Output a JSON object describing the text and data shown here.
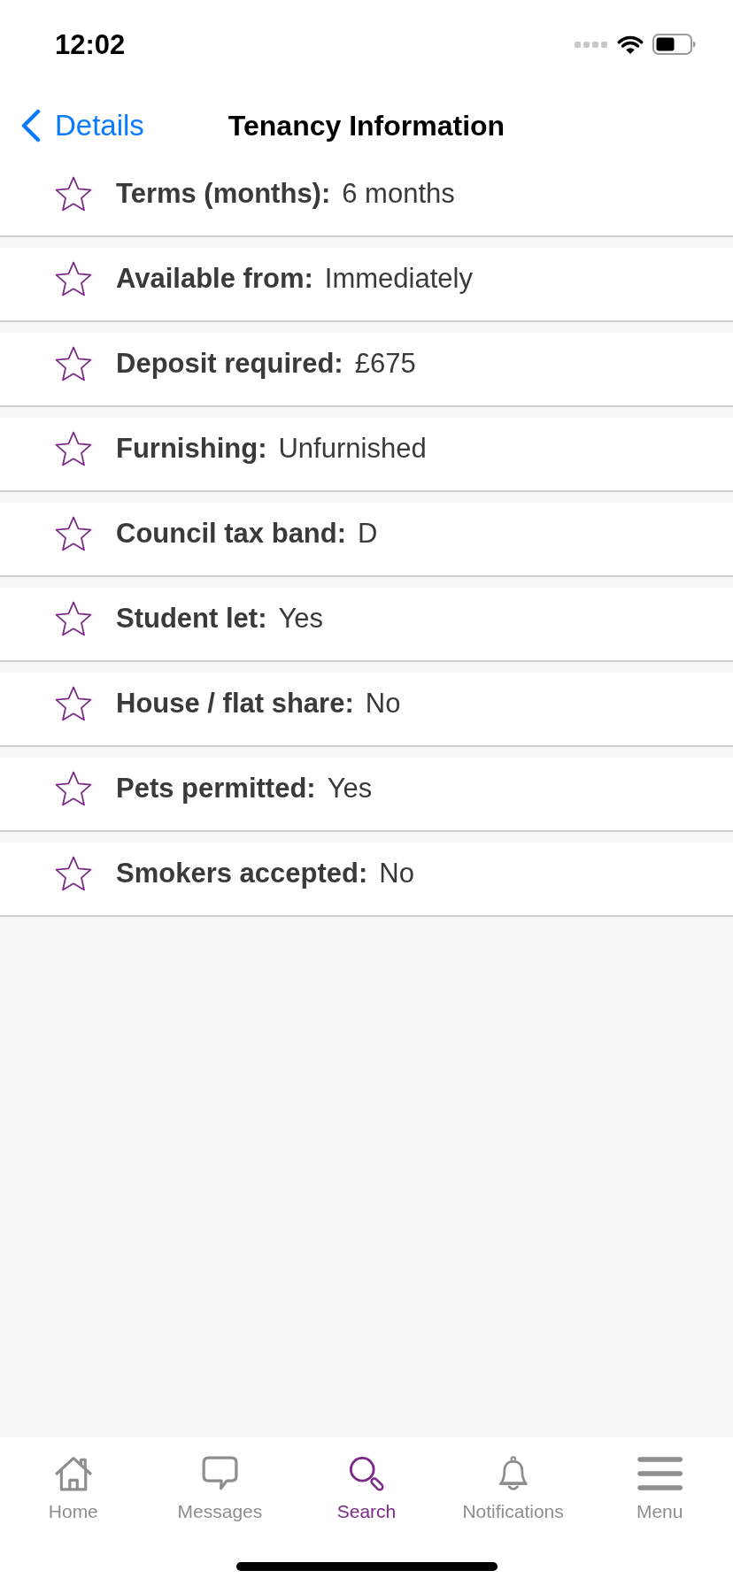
{
  "status_bar": {
    "time": "12:02"
  },
  "nav": {
    "back": "Details",
    "title": "Tenancy Information"
  },
  "rows": [
    {
      "label": "Terms (months):",
      "value": "6 months"
    },
    {
      "label": "Available from:",
      "value": "Immediately"
    },
    {
      "label": "Deposit required:",
      "value": "£675"
    },
    {
      "label": "Furnishing:",
      "value": "Unfurnished"
    },
    {
      "label": "Council tax band:",
      "value": "D"
    },
    {
      "label": "Student let:",
      "value": "Yes"
    },
    {
      "label": "House / flat share:",
      "value": "No"
    },
    {
      "label": "Pets permitted:",
      "value": "Yes"
    },
    {
      "label": "Smokers accepted:",
      "value": "No"
    }
  ],
  "tabs": [
    {
      "kind": "home",
      "label": "Home",
      "selected": false
    },
    {
      "kind": "messages",
      "label": "Messages",
      "selected": false
    },
    {
      "kind": "search",
      "label": "Search",
      "selected": true
    },
    {
      "kind": "notifications",
      "label": "Notifications",
      "selected": false
    },
    {
      "kind": "menu",
      "label": "Menu",
      "selected": false
    }
  ]
}
